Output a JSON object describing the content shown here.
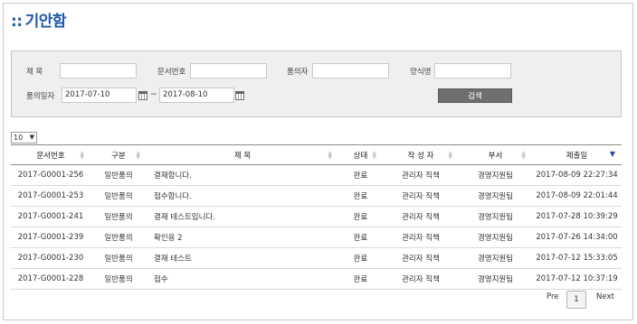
{
  "page": {
    "title": "기안함",
    "title_prefix": "::"
  },
  "search": {
    "subject_label": "제      목",
    "doc_no_label": "문서번호",
    "proposer_label": "품의자",
    "form_label": "양식명",
    "date_label": "품의일자",
    "date_from": "2017-07-10",
    "date_sep": "~",
    "date_to": "2017-08-10",
    "button_label": "검색"
  },
  "page_size": {
    "value": "10"
  },
  "table": {
    "columns": [
      "문서번호",
      "구분",
      "제      목",
      "상태",
      "작 성 자",
      "부서",
      "제출일"
    ],
    "rows": [
      [
        "2017-G0001-256",
        "일반품의",
        "결재합니다.",
        "완료",
        "관리자 직책",
        "경영지원팀",
        "2017-08-09 22:27:34"
      ],
      [
        "2017-G0001-253",
        "일반품의",
        "접수합니다.",
        "완료",
        "관리자 직책",
        "경영지원팀",
        "2017-08-09 22:01:44"
      ],
      [
        "2017-G0001-241",
        "일반품의",
        "결재 테스트입니다.",
        "완료",
        "관리자 직책",
        "경영지원팀",
        "2017-07-28 10:39:29"
      ],
      [
        "2017-G0001-239",
        "일반품의",
        "확인용 2",
        "완료",
        "관리자 직책",
        "경영지원팀",
        "2017-07-26 14:34:00"
      ],
      [
        "2017-G0001-230",
        "일반품의",
        "결재 테스트",
        "완료",
        "관리자 직책",
        "경영지원팀",
        "2017-07-12 15:33:05"
      ],
      [
        "2017-G0001-228",
        "일반품의",
        "접수",
        "완료",
        "관리자 직책",
        "경영지원팀",
        "2017-07-12 10:37:19"
      ]
    ]
  },
  "pagination": {
    "prev": "Pre",
    "current": "1",
    "next": "Next"
  },
  "colors": {
    "title": "#1e5aa8",
    "button": "#6f6f6f",
    "panel": "#efefef"
  }
}
